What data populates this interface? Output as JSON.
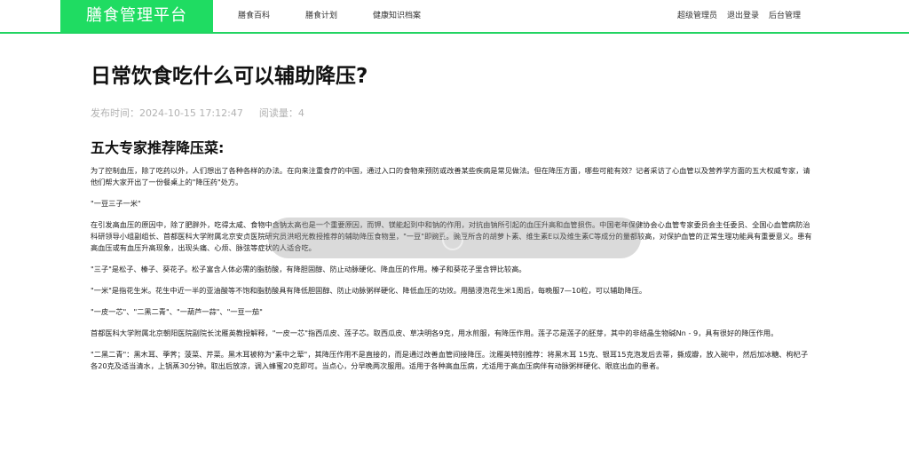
{
  "header": {
    "logo": "膳食管理平台",
    "nav": [
      "膳食百科",
      "膳食计划",
      "健康知识档案"
    ],
    "right": [
      "超级管理员",
      "退出登录",
      "后台管理"
    ]
  },
  "article": {
    "title": "日常饮食吃什么可以辅助降压?",
    "published_label": "发布时间：",
    "published_time": "2024-10-15 17:12:47",
    "views_label": "阅读量：",
    "views_count": "4",
    "section_title": "五大专家推荐降压菜:",
    "paragraphs": [
      "为了控制血压，除了吃药以外，人们想出了各种各样的办法。在向来注重食疗的中国，通过入口的食物来预防或改善某些疾病是常见做法。但在降压方面，哪些可能有效？记者采访了心血管以及营养学方面的五大权威专家，请他们帮大家开出了一份餐桌上的\"降压药\"处方。",
      "\"一豆三子一米\"",
      "在引发高血压的原因中，除了肥胖外，吃得太咸、食物中含钠太高也是一个重要原因，而钾、镁能起到中和钠的作用，对抗由钠所引起的血压升高和血管损伤。中国老年保健协会心血管专家委员会主任委员、全国心血管病防治科研领导小组副组长、首都医科大学附属北京安贞医院研究员洪昭光教授推荐的辅助降压食物里，\"一豆\"即豌豆。豌豆所含的胡萝卜素、维生素E以及维生素C等成分的量都较高，对保护血管的正常生理功能具有重要意义。患有高血压或有血压升高现象，出现头痛、心烦、脉弦等症状的人适合吃。",
      "\"三子\"是松子、榛子、葵花子。松子富含人体必需的脂肪酸，有降胆固醇、防止动脉硬化、降血压的作用。榛子和葵花子里含钾比较高。",
      "\"一米\"是指花生米。花生中近一半的亚油酸等不饱和脂肪酸具有降低胆固醇、防止动脉粥样硬化、降低血压的功效。用醋浸泡花生米1周后，每晚服7—10粒，可以辅助降压。",
      "\"一皮一芯\"、\"二黑二青\"、\"一葫芦一蒜\"、\"一豆一茄\"",
      "首都医科大学附属北京朝阳医院副院长沈雁英教授解释，\"一皮一芯\"指西瓜皮、莲子芯。取西瓜皮、草决明各9克，用水煎服，有降压作用。莲子芯是莲子的胚芽，其中的非结晶生物碱Nn - 9，具有很好的降压作用。",
      "\"二黑二青\"：黑木耳、荸荠；菠菜、芹菜。黑木耳被称为\"素中之荤\"，其降压作用不是直接的，而是通过改善血管间接降压。沈雁英特别推荐：将黑木耳 15克、银耳15克泡发后去蒂，撕成瓣，放入碗中，然后加冰糖、枸杞子各20克及适当清水，上锅蒸30分钟。取出后放凉，调入蜂蜜20克即可。当点心，分早晚两次服用。适用于各种高血压病，尤适用于高血压病伴有动脉粥样硬化、眼底出血的患者。"
    ]
  }
}
